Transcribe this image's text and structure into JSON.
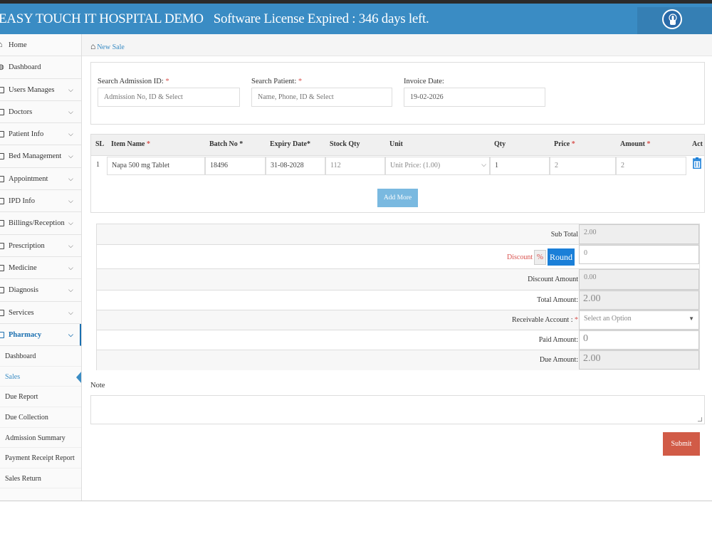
{
  "header": {
    "app_title": "EASY TOUCH IT HOSPITAL DEMO",
    "license_text": "Software License Expired : 346 days left.",
    "touch_icon": "hand-touch-icon"
  },
  "sidebar": {
    "items": [
      {
        "label": "Home",
        "icon": "home-icon",
        "has_chevron": false
      },
      {
        "label": "Dashboard",
        "icon": "dashboard-icon",
        "has_chevron": false
      },
      {
        "label": "Users Manages",
        "icon": "checkbox-icon",
        "has_chevron": true
      },
      {
        "label": "Doctors",
        "icon": "checkbox-icon",
        "has_chevron": true
      },
      {
        "label": "Patient Info",
        "icon": "checkbox-icon",
        "has_chevron": true
      },
      {
        "label": "Bed Management",
        "icon": "checkbox-icon",
        "has_chevron": true
      },
      {
        "label": "Appointment",
        "icon": "checkbox-icon",
        "has_chevron": true
      },
      {
        "label": "IPD Info",
        "icon": "checkbox-icon",
        "has_chevron": true
      },
      {
        "label": "Billings/Reception",
        "icon": "checkbox-icon",
        "has_chevron": true
      },
      {
        "label": "Prescription",
        "icon": "checkbox-icon",
        "has_chevron": true
      },
      {
        "label": "Medicine",
        "icon": "checkbox-icon",
        "has_chevron": true
      },
      {
        "label": "Diagnosis",
        "icon": "checkbox-icon",
        "has_chevron": true
      },
      {
        "label": "Services",
        "icon": "checkbox-icon",
        "has_chevron": true
      },
      {
        "label": "Pharmacy",
        "icon": "checkbox-icon",
        "has_chevron": true
      }
    ],
    "pharmacy_sub": [
      {
        "label": "Dashboard"
      },
      {
        "label": "Sales"
      },
      {
        "label": "Due Report"
      },
      {
        "label": "Due Collection"
      },
      {
        "label": "Admission Summary"
      },
      {
        "label": "Payment Receipt Report"
      },
      {
        "label": "Sales Return"
      }
    ],
    "active_item": "Pharmacy",
    "active_sub": "Sales"
  },
  "breadcrumb": {
    "label": "New Sale",
    "icon": "home-icon"
  },
  "search": {
    "admission_label": "Search Admission ID:",
    "admission_placeholder": "Admission No, ID & Select",
    "patient_label": "Search Patient:",
    "patient_placeholder": "Name, Phone, ID & Select",
    "invoice_label": "Invoice Date:",
    "invoice_value": "19-02-2026",
    "required_mark": "*"
  },
  "items_table": {
    "headers": {
      "sl": "SL",
      "item_name": "Item Name",
      "batch_no": "Batch No",
      "expiry_date": "Expiry Date*",
      "stock_qty": "Stock Qty",
      "unit": "Unit",
      "qty": "Qty",
      "price": "Price",
      "amount": "Amount",
      "act": "Act"
    },
    "rows": [
      {
        "sl": "1",
        "item_name": "Napa 500 mg Tablet",
        "batch_no": "18496",
        "expiry_date": "31-08-2028",
        "stock_qty": "112",
        "unit": "Unit Price: (1.00)",
        "qty": "1",
        "price": "2",
        "amount": "2"
      }
    ],
    "add_more_label": "Add More"
  },
  "summary": {
    "sub_total_label": "Sub Total",
    "sub_total_value": "2.00",
    "discount_label": "Discount",
    "discount_pct_label": "%",
    "round_label": "Round",
    "discount_value": "0",
    "discount_amount_label": "Discount Amount",
    "discount_amount_value": "0.00",
    "total_amount_label": "Total Amount:",
    "total_amount_value": "2.00",
    "receivable_account_label": "Receivable Account :",
    "receivable_account_placeholder": "Select an Option",
    "paid_amount_label": "Paid Amount:",
    "paid_amount_value": "0",
    "due_amount_label": "Due Amount:",
    "due_amount_value": "2.00"
  },
  "note": {
    "label": "Note",
    "value": ""
  },
  "submit_label": "Submit",
  "colors": {
    "brand": "#3a8cc4",
    "required": "#d9534f",
    "submit": "#d15b47",
    "round": "#1a7fd8"
  }
}
